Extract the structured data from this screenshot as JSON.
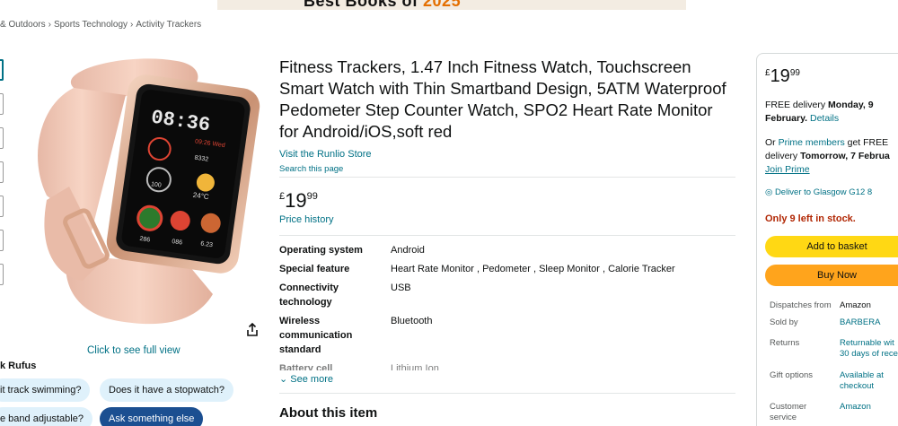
{
  "banner": {
    "text_main": "Best Books of ",
    "text_year": "2025"
  },
  "breadcrumb": [
    "& Outdoors",
    "Sports Technology",
    "Activity Trackers"
  ],
  "gallery": {
    "full_view": "Click to see full view",
    "watch_time": "08:36",
    "watch_small": [
      "09:26 Wed",
      "8332",
      "100",
      "24°C",
      "286",
      "086",
      "6.23"
    ]
  },
  "rufus": {
    "title": "k Rufus",
    "chips": [
      "it track swimming?",
      "Does it have a stopwatch?",
      "e band adjustable?",
      "Ask something else"
    ]
  },
  "product": {
    "title": "Fitness Trackers, 1.47 Inch Fitness Watch, Touchscreen Smart Watch with Thin Smartband Design, 5ATM Waterproof Pedometer Step Counter Watch, SPO2 Heart Rate Monitor for Android/iOS,soft red",
    "store_link": "Visit the Runlio Store",
    "search_link": "Search this page",
    "price_symbol": "£",
    "price_whole": "19",
    "price_fraction": "99",
    "price_history": "Price history",
    "specs": [
      {
        "key": "Operating system",
        "value": "Android"
      },
      {
        "key": "Special feature",
        "value": "Heart Rate Monitor , Pedometer , Sleep Monitor , Calorie Tracker"
      },
      {
        "key": "Connectivity technology",
        "value": "USB"
      },
      {
        "key": "Wireless communication standard",
        "value": "Bluetooth"
      },
      {
        "key": "Battery cell",
        "value": "Lithium Ion"
      }
    ],
    "see_more": "See more",
    "about_title": "About this item"
  },
  "buybox": {
    "price_symbol": "£",
    "price_whole": "19",
    "price_fraction": "99",
    "free_delivery_prefix": "FREE delivery ",
    "free_delivery_date": "Monday, 9",
    "free_delivery_date2": "February",
    "details_link": "Details",
    "or_text": "Or ",
    "prime_members": "Prime members",
    "get_free": " get FREE",
    "delivery_prefix": "delivery ",
    "fast_date": "Tomorrow, 7 Februa",
    "join_prime": "Join Prime",
    "deliver_to": "Deliver to Glasgow G12 8",
    "stock": "Only 9 left in stock.",
    "add_to_basket": "Add to basket",
    "buy_now": "Buy Now",
    "info": [
      {
        "key": "Dispatches from",
        "value": "Amazon"
      },
      {
        "key": "Sold by",
        "value": "BARBERA"
      },
      {
        "key": "Returns",
        "value": "Returnable wit",
        "value2": "30 days of rece"
      },
      {
        "key": "Gift options",
        "value": "Available at",
        "value2": "checkout"
      },
      {
        "key": "Customer",
        "key2": "service",
        "value": "Amazon"
      }
    ]
  },
  "colors": {
    "link": "#007185",
    "stock": "#b12704",
    "basket": "#ffd814",
    "buy": "#ffa41c",
    "chip": "#dff1fb",
    "chip_dark": "#1b4f91"
  }
}
